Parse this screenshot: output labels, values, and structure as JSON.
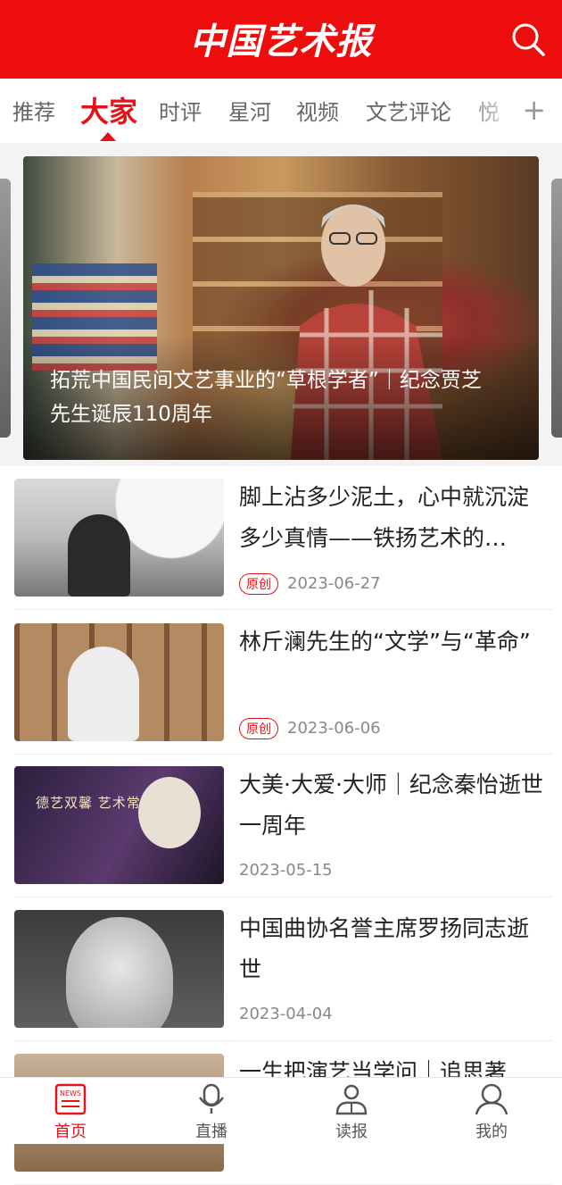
{
  "header": {
    "logo_text": "中国艺术报",
    "search_icon": "search-icon",
    "brand_color": "#ee0d0d"
  },
  "tabs": [
    {
      "label": "推荐"
    },
    {
      "label": "大家",
      "active": true
    },
    {
      "label": "时评"
    },
    {
      "label": "星河"
    },
    {
      "label": "视频"
    },
    {
      "label": "文艺评论"
    },
    {
      "label": "悦"
    }
  ],
  "tab_add_label": "+",
  "banner": {
    "title": "拓荒中国民间文艺事业的“草根学者”｜纪念贾芝先生诞辰110周年"
  },
  "articles": [
    {
      "title": "脚上沾多少泥土，心中就沉淀多少真情——铁扬艺术的…",
      "badge": "原创",
      "date": "2023-06-27"
    },
    {
      "title": "林斤澜先生的“文学”与“革命”",
      "badge": "原创",
      "date": "2023-06-06"
    },
    {
      "title": "大美·大爱·大师｜纪念秦怡逝世一周年",
      "badge": "",
      "date": "2023-05-15",
      "thumb_text": "德艺双馨 艺术常青"
    },
    {
      "title": "中国曲协名誉主席罗扬同志逝世",
      "badge": "",
      "date": "2023-04-04"
    },
    {
      "title": "一生把演艺当学问｜追思著",
      "badge": "",
      "date": ""
    }
  ],
  "bottom_nav": [
    {
      "label": "首页",
      "icon": "news-icon",
      "active": true
    },
    {
      "label": "直播",
      "icon": "microphone-icon"
    },
    {
      "label": "读报",
      "icon": "reader-icon"
    },
    {
      "label": "我的",
      "icon": "user-icon"
    }
  ],
  "accent_color": "#e4131a"
}
